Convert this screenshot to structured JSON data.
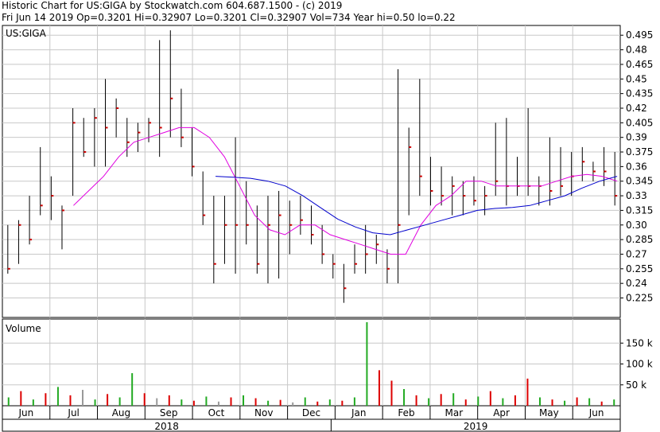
{
  "header": {
    "line1": "Historic Chart for US:GIGA by Stockwatch.com 604.687.1500 - (c) 2019",
    "line2": "Fri Jun 14 2019   Op=0.3201   Hi=0.32907   Lo=0.3201   Cl=0.32907   Vol=734   Year hi=0.50   lo=0.22"
  },
  "price_panel": {
    "label": "US:GIGA"
  },
  "volume_panel": {
    "label": "Volume"
  },
  "chart_data": {
    "type": "ohlc",
    "title": "Historic Chart for US:GIGA by Stockwatch.com 604.687.1500 - (c) 2019",
    "price_axis": {
      "ylim": [
        0.205,
        0.505
      ],
      "ticks": [
        "0.495",
        "0.48",
        "0.465",
        "0.45",
        "0.435",
        "0.42",
        "0.405",
        "0.39",
        "0.375",
        "0.36",
        "0.345",
        "0.33",
        "0.315",
        "0.30",
        "0.285",
        "0.27",
        "0.255",
        "0.24",
        "0.225"
      ],
      "position": "right",
      "grid": true
    },
    "volume_axis": {
      "ylim": [
        0,
        200000
      ],
      "ticks": [
        {
          "value": 150000,
          "label": "150 k"
        },
        {
          "value": 100000,
          "label": "100 k"
        },
        {
          "value": 50000,
          "label": "50 k"
        }
      ],
      "position": "right"
    },
    "x_axis": {
      "months": [
        "Jun",
        "Jul",
        "Aug",
        "Sep",
        "Oct",
        "Nov",
        "Dec",
        "Jan",
        "Feb",
        "Mar",
        "Apr",
        "May",
        "Jun"
      ],
      "years": [
        "2018",
        "2019"
      ]
    },
    "bars": [
      {
        "high": 0.3,
        "low": 0.25,
        "close": 0.255
      },
      {
        "high": 0.305,
        "low": 0.26,
        "close": 0.3
      },
      {
        "high": 0.33,
        "low": 0.28,
        "close": 0.285
      },
      {
        "high": 0.38,
        "low": 0.31,
        "close": 0.32
      },
      {
        "high": 0.35,
        "low": 0.305,
        "close": 0.33
      },
      {
        "high": 0.32,
        "low": 0.275,
        "close": 0.315
      },
      {
        "high": 0.42,
        "low": 0.33,
        "close": 0.405
      },
      {
        "high": 0.41,
        "low": 0.37,
        "close": 0.375
      },
      {
        "high": 0.42,
        "low": 0.36,
        "close": 0.41
      },
      {
        "high": 0.45,
        "low": 0.36,
        "close": 0.4
      },
      {
        "high": 0.43,
        "low": 0.39,
        "close": 0.42
      },
      {
        "high": 0.41,
        "low": 0.37,
        "close": 0.385
      },
      {
        "high": 0.405,
        "low": 0.375,
        "close": 0.395
      },
      {
        "high": 0.41,
        "low": 0.385,
        "close": 0.405
      },
      {
        "high": 0.49,
        "low": 0.37,
        "close": 0.4
      },
      {
        "high": 0.5,
        "low": 0.39,
        "close": 0.43
      },
      {
        "high": 0.44,
        "low": 0.38,
        "close": 0.39
      },
      {
        "high": 0.4,
        "low": 0.35,
        "close": 0.36
      },
      {
        "high": 0.355,
        "low": 0.3,
        "close": 0.31
      },
      {
        "high": 0.33,
        "low": 0.24,
        "close": 0.26
      },
      {
        "high": 0.33,
        "low": 0.26,
        "close": 0.3
      },
      {
        "high": 0.39,
        "low": 0.25,
        "close": 0.3
      },
      {
        "high": 0.345,
        "low": 0.28,
        "close": 0.3
      },
      {
        "high": 0.32,
        "low": 0.25,
        "close": 0.26
      },
      {
        "high": 0.33,
        "low": 0.24,
        "close": 0.3
      },
      {
        "high": 0.335,
        "low": 0.245,
        "close": 0.31
      },
      {
        "high": 0.325,
        "low": 0.27,
        "close": 0.3
      },
      {
        "high": 0.33,
        "low": 0.29,
        "close": 0.305
      },
      {
        "high": 0.32,
        "low": 0.28,
        "close": 0.29
      },
      {
        "high": 0.3,
        "low": 0.26,
        "close": 0.27
      },
      {
        "high": 0.27,
        "low": 0.245,
        "close": 0.26
      },
      {
        "high": 0.26,
        "low": 0.22,
        "close": 0.235
      },
      {
        "high": 0.28,
        "low": 0.25,
        "close": 0.26
      },
      {
        "high": 0.3,
        "low": 0.25,
        "close": 0.27
      },
      {
        "high": 0.29,
        "low": 0.26,
        "close": 0.28
      },
      {
        "high": 0.275,
        "low": 0.24,
        "close": 0.255
      },
      {
        "high": 0.46,
        "low": 0.24,
        "close": 0.3
      },
      {
        "high": 0.4,
        "low": 0.31,
        "close": 0.38
      },
      {
        "high": 0.45,
        "low": 0.33,
        "close": 0.35
      },
      {
        "high": 0.37,
        "low": 0.32,
        "close": 0.335
      },
      {
        "high": 0.36,
        "low": 0.32,
        "close": 0.33
      },
      {
        "high": 0.35,
        "low": 0.31,
        "close": 0.34
      },
      {
        "high": 0.345,
        "low": 0.31,
        "close": 0.33
      },
      {
        "high": 0.35,
        "low": 0.32,
        "close": 0.325
      },
      {
        "high": 0.34,
        "low": 0.31,
        "close": 0.33
      },
      {
        "high": 0.405,
        "low": 0.33,
        "close": 0.345
      },
      {
        "high": 0.41,
        "low": 0.32,
        "close": 0.34
      },
      {
        "high": 0.37,
        "low": 0.33,
        "close": 0.34
      },
      {
        "high": 0.42,
        "low": 0.33,
        "close": 0.34
      },
      {
        "high": 0.35,
        "low": 0.32,
        "close": 0.34
      },
      {
        "high": 0.39,
        "low": 0.32,
        "close": 0.335
      },
      {
        "high": 0.38,
        "low": 0.33,
        "close": 0.34
      },
      {
        "high": 0.375,
        "low": 0.33,
        "close": 0.35
      },
      {
        "high": 0.38,
        "low": 0.345,
        "close": 0.365
      },
      {
        "high": 0.365,
        "low": 0.345,
        "close": 0.355
      },
      {
        "high": 0.38,
        "low": 0.34,
        "close": 0.355
      },
      {
        "high": 0.375,
        "low": 0.32,
        "close": 0.33
      }
    ],
    "ma_short": [
      0.32,
      0.335,
      0.35,
      0.37,
      0.385,
      0.39,
      0.395,
      0.4,
      0.4,
      0.39,
      0.37,
      0.34,
      0.31,
      0.295,
      0.29,
      0.3,
      0.3,
      0.29,
      0.285,
      0.28,
      0.275,
      0.27,
      0.27,
      0.3,
      0.32,
      0.33,
      0.345,
      0.345,
      0.34,
      0.34,
      0.34,
      0.34,
      0.345,
      0.35,
      0.352,
      0.35,
      0.345
    ],
    "ma_long": [
      0.35,
      0.349,
      0.348,
      0.345,
      0.34,
      0.33,
      0.318,
      0.306,
      0.298,
      0.292,
      0.29,
      0.295,
      0.3,
      0.305,
      0.31,
      0.315,
      0.317,
      0.318,
      0.32,
      0.325,
      0.33,
      0.338,
      0.345,
      0.35
    ],
    "volume": [
      {
        "v": 20000,
        "dir": "up"
      },
      {
        "v": 35000,
        "dir": "down"
      },
      {
        "v": 15000,
        "dir": "up"
      },
      {
        "v": 30000,
        "dir": "down"
      },
      {
        "v": 45000,
        "dir": "up"
      },
      {
        "v": 25000,
        "dir": "down"
      },
      {
        "v": 38000,
        "dir": "flat"
      },
      {
        "v": 15000,
        "dir": "up"
      },
      {
        "v": 28000,
        "dir": "down"
      },
      {
        "v": 20000,
        "dir": "up"
      },
      {
        "v": 78000,
        "dir": "up"
      },
      {
        "v": 30000,
        "dir": "down"
      },
      {
        "v": 18000,
        "dir": "flat"
      },
      {
        "v": 25000,
        "dir": "down"
      },
      {
        "v": 15000,
        "dir": "up"
      },
      {
        "v": 12000,
        "dir": "down"
      },
      {
        "v": 22000,
        "dir": "up"
      },
      {
        "v": 10000,
        "dir": "flat"
      },
      {
        "v": 20000,
        "dir": "down"
      },
      {
        "v": 25000,
        "dir": "up"
      },
      {
        "v": 18000,
        "dir": "down"
      },
      {
        "v": 12000,
        "dir": "up"
      },
      {
        "v": 14000,
        "dir": "down"
      },
      {
        "v": 8000,
        "dir": "flat"
      },
      {
        "v": 20000,
        "dir": "up"
      },
      {
        "v": 10000,
        "dir": "down"
      },
      {
        "v": 15000,
        "dir": "up"
      },
      {
        "v": 12000,
        "dir": "down"
      },
      {
        "v": 20000,
        "dir": "up"
      },
      {
        "v": 200000,
        "dir": "up"
      },
      {
        "v": 85000,
        "dir": "down"
      },
      {
        "v": 60000,
        "dir": "down"
      },
      {
        "v": 40000,
        "dir": "up"
      },
      {
        "v": 25000,
        "dir": "down"
      },
      {
        "v": 18000,
        "dir": "up"
      },
      {
        "v": 28000,
        "dir": "down"
      },
      {
        "v": 30000,
        "dir": "up"
      },
      {
        "v": 15000,
        "dir": "down"
      },
      {
        "v": 22000,
        "dir": "up"
      },
      {
        "v": 35000,
        "dir": "down"
      },
      {
        "v": 18000,
        "dir": "up"
      },
      {
        "v": 25000,
        "dir": "down"
      },
      {
        "v": 65000,
        "dir": "down"
      },
      {
        "v": 20000,
        "dir": "up"
      },
      {
        "v": 15000,
        "dir": "down"
      },
      {
        "v": 12000,
        "dir": "up"
      },
      {
        "v": 20000,
        "dir": "down"
      },
      {
        "v": 18000,
        "dir": "up"
      },
      {
        "v": 10000,
        "dir": "down"
      },
      {
        "v": 15000,
        "dir": "up"
      }
    ]
  }
}
